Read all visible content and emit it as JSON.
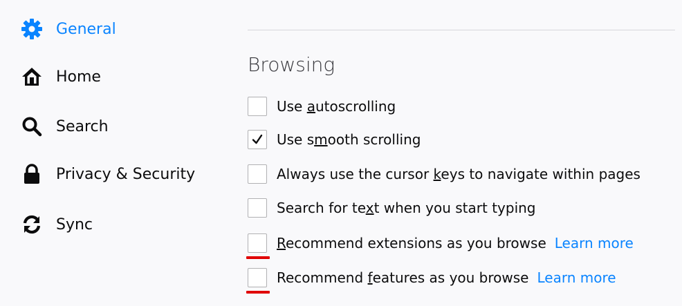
{
  "theme": {
    "accent": "#0a84ff",
    "text": "#0c0c0d",
    "annotation": "#e00000"
  },
  "sidebar": {
    "items": [
      {
        "label": "General",
        "icon": "gear-icon",
        "selected": true
      },
      {
        "label": "Home",
        "icon": "home-icon",
        "selected": false
      },
      {
        "label": "Search",
        "icon": "search-icon",
        "selected": false
      },
      {
        "label": "Privacy & Security",
        "icon": "lock-icon",
        "selected": false
      },
      {
        "label": "Sync",
        "icon": "sync-icon",
        "selected": false
      }
    ]
  },
  "main": {
    "section_title": "Browsing",
    "options": [
      {
        "pre": "Use ",
        "access": "a",
        "post": "utoscrolling",
        "checked": false
      },
      {
        "pre": "Use s",
        "access": "m",
        "post": "ooth scrolling",
        "checked": true
      },
      {
        "pre": "Always use the cursor ",
        "access": "k",
        "post": "eys to navigate within pages",
        "checked": false
      },
      {
        "pre": "Search for te",
        "access": "x",
        "post": "t when you start typing",
        "checked": false
      },
      {
        "pre": "",
        "access": "R",
        "post": "ecommend extensions as you browse",
        "checked": false,
        "link": "Learn more"
      },
      {
        "pre": "Recommend ",
        "access": "f",
        "post": "eatures as you browse",
        "checked": false,
        "link": "Learn more"
      }
    ]
  }
}
